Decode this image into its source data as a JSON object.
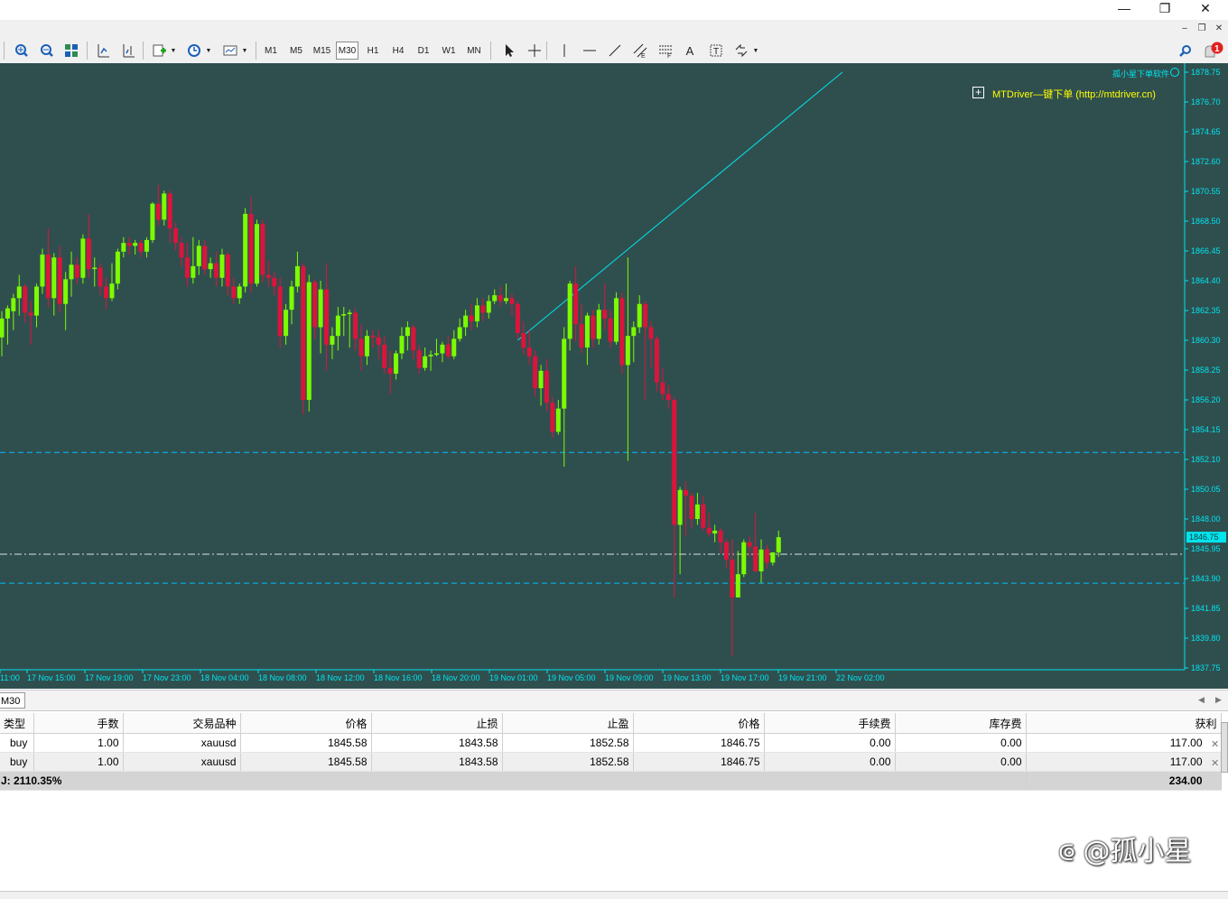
{
  "window": {
    "minimize_glyph": "—",
    "restore_glyph": "❐",
    "close_glyph": "✕",
    "mdi_minimize": "–",
    "mdi_restore": "❐",
    "mdi_close": "✕"
  },
  "toolbar": {
    "timeframes": [
      {
        "label": "M1",
        "active": false
      },
      {
        "label": "M5",
        "active": false
      },
      {
        "label": "M15",
        "active": false
      },
      {
        "label": "M30",
        "active": true
      },
      {
        "label": "H1",
        "active": false
      },
      {
        "label": "H4",
        "active": false
      },
      {
        "label": "D1",
        "active": false
      },
      {
        "label": "W1",
        "active": false
      },
      {
        "label": "MN",
        "active": false
      }
    ],
    "notification_count": "1",
    "text_tool_label": "A"
  },
  "chart": {
    "symbol_timeframe_tab": "M30",
    "plugin_header": "孤小星下单软件",
    "plugin_label": "MTDriver—键下单 (http://mtdriver.cn)",
    "plugin_box_glyph": "+",
    "current_price_label": "1846.75",
    "price_axis_labels": [
      "1878.75",
      "1876.70",
      "1874.65",
      "1872.60",
      "1870.55",
      "1868.50",
      "1866.45",
      "1864.40",
      "1862.35",
      "1860.30",
      "1858.25",
      "1856.20",
      "1854.15",
      "1852.10",
      "1850.05",
      "1848.00",
      "1845.95",
      "1843.90",
      "1841.85",
      "1839.80",
      "1837.75"
    ],
    "time_axis_labels": [
      "11:00",
      "17 Nov 15:00",
      "17 Nov 19:00",
      "17 Nov 23:00",
      "18 Nov 04:00",
      "18 Nov 08:00",
      "18 Nov 12:00",
      "18 Nov 16:00",
      "18 Nov 20:00",
      "19 Nov 01:00",
      "19 Nov 05:00",
      "19 Nov 09:00",
      "19 Nov 13:00",
      "19 Nov 17:00",
      "19 Nov 21:00",
      "22 Nov 02:00"
    ],
    "colors": {
      "background": "#2f4f4f",
      "bull": "#7cfc00",
      "bear": "#dc143c",
      "axis_text": "#00e5ee",
      "plugin_text": "#ffff00",
      "levels": "#00bfff",
      "bid_line": "#e0e0e0",
      "trendline": "#00e5ee"
    },
    "levels": {
      "take_profit": 1852.58,
      "open_price": 1845.58,
      "stop_loss": 1843.58
    }
  },
  "chart_data": {
    "type": "candlestick",
    "symbol": "xauusd",
    "timeframe": "M30",
    "ylim": [
      1837.75,
      1878.75
    ],
    "candles": [
      [
        1860.5,
        1862.3,
        1859.2,
        1861.8
      ],
      [
        1861.8,
        1862.7,
        1860.0,
        1862.5
      ],
      [
        1862.3,
        1863.5,
        1861.0,
        1863.2
      ],
      [
        1863.2,
        1864.8,
        1862.0,
        1864.0
      ],
      [
        1864.0,
        1864.2,
        1861.5,
        1862.2
      ],
      [
        1862.2,
        1863.0,
        1860.0,
        1862.0
      ],
      [
        1862.0,
        1864.2,
        1861.2,
        1864.0
      ],
      [
        1864.0,
        1866.6,
        1863.5,
        1866.2
      ],
      [
        1866.2,
        1868.0,
        1862.6,
        1863.2
      ],
      [
        1863.2,
        1866.3,
        1862.0,
        1866.0
      ],
      [
        1866.0,
        1866.8,
        1862.2,
        1862.8
      ],
      [
        1862.8,
        1865.0,
        1861.0,
        1864.5
      ],
      [
        1864.5,
        1866.4,
        1863.3,
        1865.5
      ],
      [
        1865.5,
        1866.0,
        1864.2,
        1864.6
      ],
      [
        1864.6,
        1867.6,
        1864.2,
        1867.3
      ],
      [
        1867.3,
        1869.0,
        1864.6,
        1865.2
      ],
      [
        1865.2,
        1866.0,
        1864.0,
        1865.3
      ],
      [
        1865.3,
        1865.6,
        1863.4,
        1864.0
      ],
      [
        1864.0,
        1864.6,
        1862.4,
        1863.2
      ],
      [
        1863.2,
        1865.6,
        1863.0,
        1864.2
      ],
      [
        1864.2,
        1866.6,
        1863.8,
        1866.4
      ],
      [
        1866.4,
        1867.4,
        1866.0,
        1867.0
      ],
      [
        1867.0,
        1867.4,
        1866.2,
        1866.8
      ],
      [
        1866.8,
        1867.2,
        1866.2,
        1867.0
      ],
      [
        1867.0,
        1867.2,
        1866.0,
        1866.4
      ],
      [
        1866.4,
        1867.4,
        1866.0,
        1867.2
      ],
      [
        1867.2,
        1869.8,
        1867.0,
        1869.7
      ],
      [
        1869.7,
        1871.0,
        1868.2,
        1868.6
      ],
      [
        1868.6,
        1870.6,
        1868.2,
        1870.4
      ],
      [
        1870.4,
        1870.6,
        1867.0,
        1868.0
      ],
      [
        1868.0,
        1868.4,
        1866.5,
        1867.0
      ],
      [
        1867.0,
        1867.4,
        1865.4,
        1866.0
      ],
      [
        1866.0,
        1867.0,
        1864.0,
        1864.6
      ],
      [
        1864.6,
        1867.4,
        1864.2,
        1865.4
      ],
      [
        1865.4,
        1867.2,
        1864.8,
        1866.8
      ],
      [
        1866.8,
        1867.2,
        1864.8,
        1865.2
      ],
      [
        1865.2,
        1866.0,
        1864.6,
        1865.6
      ],
      [
        1865.6,
        1866.4,
        1864.0,
        1864.6
      ],
      [
        1864.6,
        1866.6,
        1864.0,
        1866.2
      ],
      [
        1866.2,
        1866.4,
        1863.4,
        1864.0
      ],
      [
        1864.0,
        1864.6,
        1862.8,
        1863.2
      ],
      [
        1863.2,
        1864.2,
        1862.8,
        1864.0
      ],
      [
        1864.0,
        1869.4,
        1863.6,
        1869.0
      ],
      [
        1869.0,
        1870.2,
        1863.6,
        1864.2
      ],
      [
        1864.2,
        1868.6,
        1864.0,
        1868.3
      ],
      [
        1868.3,
        1868.6,
        1864.3,
        1864.8
      ],
      [
        1864.8,
        1865.8,
        1864.0,
        1864.6
      ],
      [
        1864.6,
        1865.0,
        1863.4,
        1864.0
      ],
      [
        1864.0,
        1864.6,
        1859.8,
        1860.6
      ],
      [
        1860.6,
        1862.8,
        1860.0,
        1862.4
      ],
      [
        1862.4,
        1864.4,
        1861.4,
        1864.0
      ],
      [
        1864.0,
        1866.4,
        1863.6,
        1865.4
      ],
      [
        1865.4,
        1865.6,
        1855.2,
        1856.2
      ],
      [
        1856.2,
        1864.8,
        1855.4,
        1864.3
      ],
      [
        1864.3,
        1864.5,
        1860.4,
        1861.2
      ],
      [
        1861.2,
        1864.4,
        1859.4,
        1863.8
      ],
      [
        1863.8,
        1865.6,
        1858.2,
        1860.0
      ],
      [
        1860.0,
        1861.2,
        1859.0,
        1860.6
      ],
      [
        1860.6,
        1862.6,
        1859.6,
        1862.0
      ],
      [
        1862.0,
        1862.6,
        1860.6,
        1862.1
      ],
      [
        1862.1,
        1862.4,
        1859.8,
        1862.2
      ],
      [
        1862.2,
        1862.5,
        1859.6,
        1860.4
      ],
      [
        1860.4,
        1861.4,
        1858.2,
        1859.2
      ],
      [
        1859.2,
        1861.0,
        1858.6,
        1860.6
      ],
      [
        1860.6,
        1861.0,
        1859.8,
        1860.5
      ],
      [
        1860.5,
        1861.0,
        1859.0,
        1860.0
      ],
      [
        1860.0,
        1860.6,
        1858.0,
        1858.4
      ],
      [
        1858.4,
        1859.6,
        1856.6,
        1858.0
      ],
      [
        1858.0,
        1859.6,
        1857.6,
        1859.4
      ],
      [
        1859.4,
        1861.2,
        1859.0,
        1860.6
      ],
      [
        1860.6,
        1861.6,
        1859.6,
        1861.2
      ],
      [
        1861.2,
        1861.4,
        1859.0,
        1859.6
      ],
      [
        1859.6,
        1860.0,
        1858.0,
        1858.4
      ],
      [
        1858.4,
        1859.8,
        1858.2,
        1859.2
      ],
      [
        1859.2,
        1859.6,
        1858.2,
        1859.3
      ],
      [
        1859.3,
        1860.4,
        1859.2,
        1859.4
      ],
      [
        1859.4,
        1860.2,
        1858.8,
        1860.0
      ],
      [
        1860.0,
        1860.6,
        1859.0,
        1859.2
      ],
      [
        1859.2,
        1861.0,
        1859.0,
        1860.4
      ],
      [
        1860.4,
        1861.8,
        1860.2,
        1861.2
      ],
      [
        1861.2,
        1862.4,
        1860.6,
        1862.0
      ],
      [
        1862.0,
        1862.8,
        1861.0,
        1861.6
      ],
      [
        1861.6,
        1863.2,
        1861.2,
        1862.7
      ],
      [
        1862.7,
        1863.2,
        1861.6,
        1862.2
      ],
      [
        1862.2,
        1863.4,
        1861.8,
        1863.0
      ],
      [
        1863.0,
        1863.8,
        1862.8,
        1863.4
      ],
      [
        1863.4,
        1864.0,
        1862.6,
        1863.0
      ],
      [
        1863.0,
        1864.2,
        1862.8,
        1863.2
      ],
      [
        1863.2,
        1863.5,
        1862.0,
        1862.8
      ],
      [
        1862.8,
        1863.0,
        1860.4,
        1860.8
      ],
      [
        1860.8,
        1861.6,
        1859.4,
        1859.8
      ],
      [
        1859.8,
        1861.0,
        1858.6,
        1859.2
      ],
      [
        1859.2,
        1859.6,
        1856.4,
        1857.0
      ],
      [
        1857.0,
        1858.6,
        1855.8,
        1858.2
      ],
      [
        1858.2,
        1859.0,
        1855.4,
        1856.0
      ],
      [
        1856.0,
        1856.4,
        1853.6,
        1854.0
      ],
      [
        1854.0,
        1856.2,
        1853.8,
        1855.6
      ],
      [
        1855.6,
        1861.2,
        1851.6,
        1860.4
      ],
      [
        1860.4,
        1864.4,
        1859.6,
        1864.2
      ],
      [
        1864.2,
        1865.4,
        1860.2,
        1861.4
      ],
      [
        1861.4,
        1862.8,
        1859.4,
        1859.8
      ],
      [
        1859.8,
        1862.2,
        1858.6,
        1862.0
      ],
      [
        1862.0,
        1862.4,
        1859.8,
        1860.4
      ],
      [
        1860.4,
        1862.8,
        1860.0,
        1862.4
      ],
      [
        1862.4,
        1864.2,
        1861.0,
        1861.8
      ],
      [
        1861.8,
        1862.4,
        1859.8,
        1860.2
      ],
      [
        1860.2,
        1863.6,
        1860.0,
        1863.2
      ],
      [
        1863.2,
        1863.6,
        1858.0,
        1858.6
      ],
      [
        1858.6,
        1866.0,
        1852.0,
        1860.6
      ],
      [
        1860.6,
        1861.6,
        1858.8,
        1861.2
      ],
      [
        1861.2,
        1863.4,
        1860.8,
        1862.8
      ],
      [
        1862.8,
        1863.0,
        1856.2,
        1861.2
      ],
      [
        1861.2,
        1861.6,
        1858.4,
        1860.4
      ],
      [
        1860.4,
        1860.6,
        1856.8,
        1857.4
      ],
      [
        1857.4,
        1858.4,
        1856.2,
        1856.6
      ],
      [
        1856.6,
        1857.2,
        1855.6,
        1856.2
      ],
      [
        1856.2,
        1856.4,
        1842.6,
        1847.6
      ],
      [
        1847.6,
        1850.2,
        1844.2,
        1850.0
      ],
      [
        1850.0,
        1850.6,
        1846.8,
        1849.6
      ],
      [
        1849.6,
        1849.8,
        1847.4,
        1848.0
      ],
      [
        1848.0,
        1849.8,
        1847.6,
        1849.0
      ],
      [
        1849.0,
        1849.6,
        1847.2,
        1847.4
      ],
      [
        1847.4,
        1848.4,
        1846.8,
        1847.0
      ],
      [
        1847.0,
        1847.6,
        1846.4,
        1847.2
      ],
      [
        1847.2,
        1847.4,
        1845.6,
        1846.4
      ],
      [
        1846.4,
        1846.6,
        1844.6,
        1845.2
      ],
      [
        1845.2,
        1846.6,
        1838.6,
        1842.6
      ],
      [
        1842.6,
        1845.8,
        1842.6,
        1844.2
      ],
      [
        1844.2,
        1846.6,
        1844.0,
        1846.4
      ],
      [
        1846.4,
        1846.8,
        1845.4,
        1846.1
      ],
      [
        1846.1,
        1848.4,
        1845.4,
        1844.4
      ],
      [
        1844.4,
        1846.6,
        1843.6,
        1845.9
      ],
      [
        1845.9,
        1846.2,
        1844.6,
        1845.0
      ],
      [
        1845.0,
        1845.6,
        1844.8,
        1845.7
      ],
      [
        1845.7,
        1847.2,
        1845.4,
        1846.75
      ]
    ],
    "y_axis_ticks": [
      1878.75,
      1876.7,
      1874.65,
      1872.6,
      1870.55,
      1868.5,
      1866.45,
      1864.4,
      1862.35,
      1860.3,
      1858.25,
      1856.2,
      1854.15,
      1852.1,
      1850.05,
      1848.0,
      1845.95,
      1843.9,
      1841.85,
      1839.8,
      1837.75
    ],
    "x_axis_ticks": [
      "11:00",
      "17 Nov 15:00",
      "17 Nov 19:00",
      "17 Nov 23:00",
      "18 Nov 04:00",
      "18 Nov 08:00",
      "18 Nov 12:00",
      "18 Nov 16:00",
      "18 Nov 20:00",
      "19 Nov 01:00",
      "19 Nov 05:00",
      "19 Nov 09:00",
      "19 Nov 13:00",
      "19 Nov 17:00",
      "19 Nov 21:00",
      "22 Nov 02:00"
    ],
    "horizontal_lines": [
      {
        "price": 1852.58,
        "style": "dashed"
      },
      {
        "price": 1845.58,
        "style": "dash-dot"
      },
      {
        "price": 1843.58,
        "style": "dashed"
      }
    ],
    "trendline": {
      "start": [
        89,
        1860.3
      ],
      "end": [
        145,
        1878.75
      ]
    },
    "current_price": 1846.75,
    "grid": false
  },
  "terminal": {
    "columns": [
      "类型",
      "手数",
      "交易品种",
      "价格",
      "止损",
      "止盈",
      "价格",
      "手续费",
      "库存费",
      "获利"
    ],
    "rows": [
      [
        "buy",
        "1.00",
        "xauusd",
        "1845.58",
        "1843.58",
        "1852.58",
        "1846.75",
        "0.00",
        "0.00",
        "117.00"
      ],
      [
        "buy",
        "1.00",
        "xauusd",
        "1845.58",
        "1843.58",
        "1852.58",
        "1846.75",
        "0.00",
        "0.00",
        "117.00"
      ]
    ],
    "total_label": "J: 2110.35%",
    "total_profit": "234.00",
    "row_close_glyph": "✕"
  },
  "watermark": "⟃ @孤小星"
}
